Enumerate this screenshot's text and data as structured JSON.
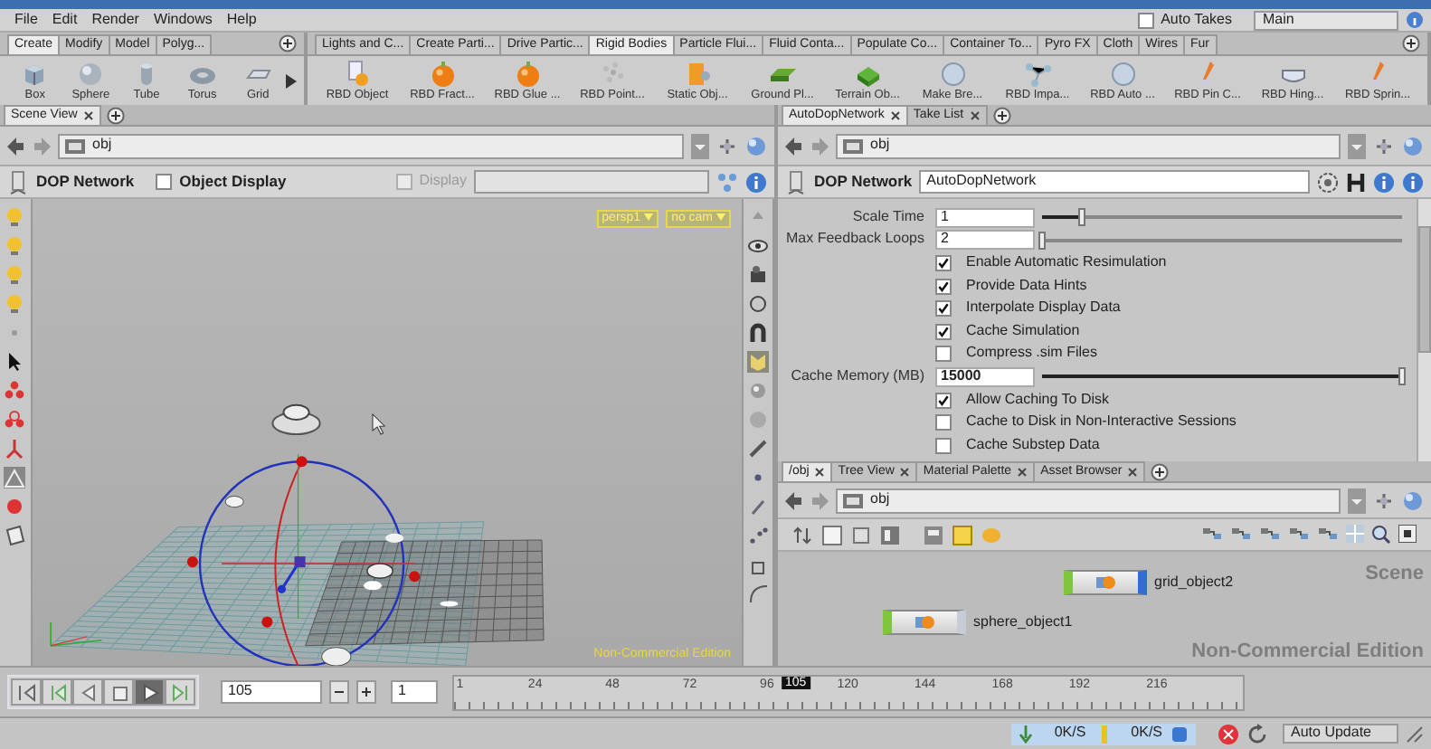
{
  "menu": [
    "File",
    "Edit",
    "Render",
    "Windows",
    "Help"
  ],
  "auto_takes": {
    "label": "Auto Takes",
    "checked": false
  },
  "desktop": "Main",
  "shelves": [
    {
      "tabs": [
        {
          "label": "Create",
          "selected": true
        },
        {
          "label": "Modify",
          "selected": false
        },
        {
          "label": "Model",
          "selected": false
        },
        {
          "label": "Polyg...",
          "selected": false
        }
      ],
      "tools": [
        "Box",
        "Sphere",
        "Tube",
        "Torus",
        "Grid"
      ]
    },
    {
      "tabs": [
        {
          "label": "Lights and C...",
          "selected": false
        },
        {
          "label": "Create Parti...",
          "selected": false
        },
        {
          "label": "Drive Partic...",
          "selected": false
        },
        {
          "label": "Rigid Bodies",
          "selected": true
        },
        {
          "label": "Particle Flui...",
          "selected": false
        },
        {
          "label": "Fluid Conta...",
          "selected": false
        },
        {
          "label": "Populate Co...",
          "selected": false
        },
        {
          "label": "Container To...",
          "selected": false
        },
        {
          "label": "Pyro FX",
          "selected": false
        },
        {
          "label": "Cloth",
          "selected": false
        },
        {
          "label": "Wires",
          "selected": false
        },
        {
          "label": "Fur",
          "selected": false
        }
      ],
      "tools": [
        "RBD Object",
        "RBD Fract...",
        "RBD Glue ...",
        "RBD Point...",
        "Static Obj...",
        "Ground Pl...",
        "Terrain Ob...",
        "Make Bre...",
        "RBD Impa...",
        "RBD Auto ...",
        "RBD Pin C...",
        "RBD Hing...",
        "RBD Sprin..."
      ]
    }
  ],
  "scene_view": {
    "tabs": [
      {
        "label": "Scene View",
        "selected": true
      }
    ],
    "path": "obj",
    "title": "DOP Network",
    "object_display": {
      "label": "Object Display",
      "checked": false
    },
    "display": {
      "label": "Display",
      "checked": false,
      "disabled": true
    },
    "camera_menus": [
      "persp1",
      "no cam"
    ],
    "edition": "Non-Commercial Edition"
  },
  "parameters": {
    "tabs": [
      {
        "label": "AutoDopNetwork",
        "selected": true
      },
      {
        "label": "Take List",
        "selected": false
      }
    ],
    "path": "obj",
    "type": "DOP Network",
    "name": "AutoDopNetwork",
    "rows": [
      {
        "kind": "slider",
        "label": "Scale Time",
        "value": "1",
        "level": 0.11
      },
      {
        "kind": "slider",
        "label": "Max Feedback Loops",
        "value": "2",
        "level": 0.0
      },
      {
        "kind": "checkbox",
        "label": "Enable Automatic Resimulation",
        "checked": true
      },
      {
        "kind": "checkbox",
        "label": "Provide Data Hints",
        "checked": true
      },
      {
        "kind": "checkbox",
        "label": "Interpolate Display Data",
        "checked": true
      },
      {
        "kind": "checkbox",
        "label": "Cache Simulation",
        "checked": true
      },
      {
        "kind": "checkbox",
        "label": "Compress .sim Files",
        "checked": false
      },
      {
        "kind": "slider",
        "label": "Cache Memory (MB)",
        "value": "15000",
        "level": 1.0
      },
      {
        "kind": "checkbox",
        "label": "Allow Caching To Disk",
        "checked": true
      },
      {
        "kind": "checkbox",
        "label": "Cache to Disk in Non-Interactive Sessions",
        "checked": false
      },
      {
        "kind": "checkbox",
        "label": "Cache Substep Data",
        "checked": false
      }
    ]
  },
  "network": {
    "tabs": [
      {
        "label": "/obj",
        "selected": true
      },
      {
        "label": "Tree View",
        "selected": false
      },
      {
        "label": "Material Palette",
        "selected": false
      },
      {
        "label": "Asset Browser",
        "selected": false
      }
    ],
    "path": "obj",
    "nodes": [
      {
        "name": "grid_object2",
        "display_flag": true
      },
      {
        "name": "sphere_object1",
        "display_flag": false
      }
    ],
    "context": "Scene",
    "edition": "Non-Commercial Edition"
  },
  "timeline": {
    "frame": "105",
    "step": "1",
    "playing": true,
    "ticks": [
      "1",
      "24",
      "48",
      "72",
      "96",
      "120",
      "144",
      "168",
      "192",
      "216"
    ],
    "current": "105",
    "level": 0.424
  },
  "status": {
    "rates": [
      "0K/S",
      "0K/S"
    ],
    "update_mode": "Auto Update"
  }
}
